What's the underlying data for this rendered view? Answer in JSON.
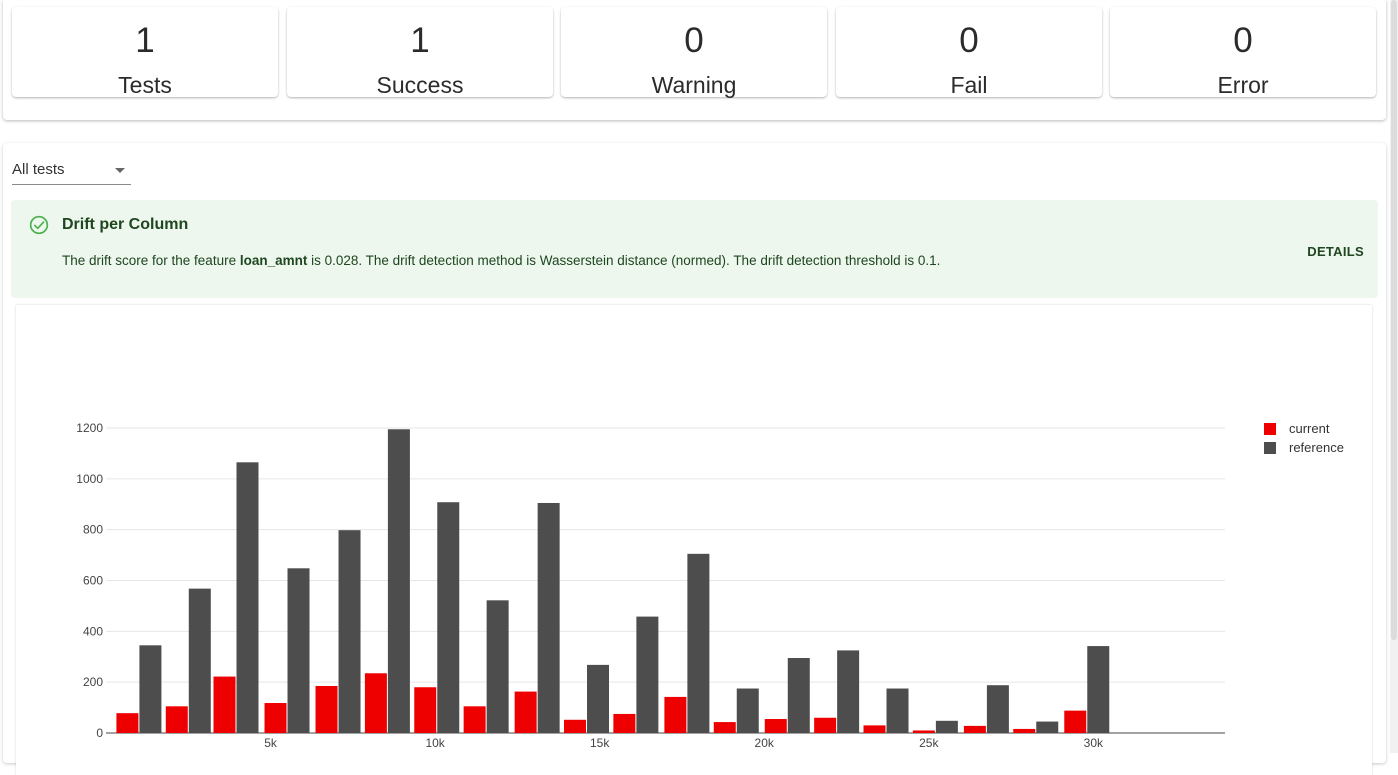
{
  "summary": {
    "cards": [
      {
        "value": "1",
        "label": "Tests"
      },
      {
        "value": "1",
        "label": "Success"
      },
      {
        "value": "0",
        "label": "Warning"
      },
      {
        "value": "0",
        "label": "Fail"
      },
      {
        "value": "0",
        "label": "Error"
      }
    ]
  },
  "filter": {
    "selected": "All tests"
  },
  "test": {
    "title": "Drift per Column",
    "status_icon": "check-circle-icon",
    "status_color": "#4caf50",
    "description_prefix": "The drift score for the feature ",
    "feature": "loan_amnt",
    "description_suffix": " is 0.028. The drift detection method is Wasserstein distance (normed). The drift detection threshold is 0.1.",
    "details_label": "DETAILS"
  },
  "chart_data": {
    "type": "bar",
    "x": [
      1000,
      2500,
      3950,
      5500,
      7050,
      8550,
      10050,
      11550,
      13100,
      14600,
      16100,
      17650,
      19150,
      20700,
      22200,
      23700,
      25200,
      26750,
      28250,
      29800,
      31300,
      32800
    ],
    "series": [
      {
        "name": "current",
        "color": "#ee0000",
        "values": [
          78,
          105,
          222,
          118,
          185,
          235,
          180,
          105,
          163,
          52,
          75,
          142,
          43,
          55,
          60,
          30,
          10,
          28,
          16,
          88
        ]
      },
      {
        "name": "reference",
        "color": "#4d4d4d",
        "values": [
          345,
          568,
          1065,
          648,
          798,
          1195,
          908,
          522,
          905,
          268,
          458,
          705,
          175,
          295,
          325,
          175,
          48,
          188,
          45,
          342
        ]
      }
    ],
    "xticks": [
      5000,
      10000,
      15000,
      20000,
      25000,
      30000
    ],
    "xtick_labels": [
      "5k",
      "10k",
      "15k",
      "20k",
      "25k",
      "30k"
    ],
    "yticks": [
      0,
      200,
      400,
      600,
      800,
      1000,
      1200
    ],
    "ylim": [
      0,
      1200
    ],
    "grid": true,
    "legend_position": "top-right"
  }
}
